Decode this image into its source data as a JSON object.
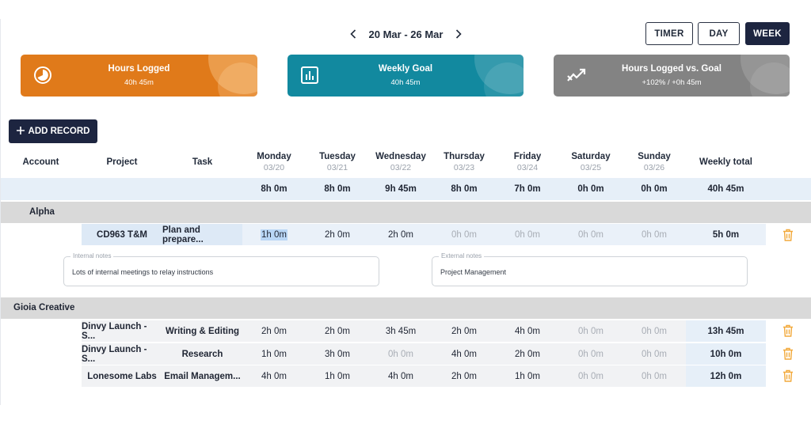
{
  "date_nav": {
    "range": "20 Mar - 26 Mar"
  },
  "views": {
    "timer": "TIMER",
    "day": "DAY",
    "week": "WEEK",
    "active": "week"
  },
  "cards": {
    "hours_logged": {
      "title": "Hours Logged",
      "value": "40h 45m",
      "color": "#e07a1a"
    },
    "weekly_goal": {
      "title": "Weekly Goal",
      "value": "40h 45m",
      "color": "#12899f"
    },
    "vs_goal": {
      "title": "Hours Logged vs. Goal",
      "value": "+102% / +0h 45m",
      "color": "#838383"
    }
  },
  "add_record": {
    "label": "ADD RECORD"
  },
  "columns": {
    "account": "Account",
    "project": "Project",
    "task": "Task",
    "days": [
      {
        "name": "Monday",
        "date": "03/20"
      },
      {
        "name": "Tuesday",
        "date": "03/21"
      },
      {
        "name": "Wednesday",
        "date": "03/22"
      },
      {
        "name": "Thursday",
        "date": "03/23"
      },
      {
        "name": "Friday",
        "date": "03/24"
      },
      {
        "name": "Saturday",
        "date": "03/25"
      },
      {
        "name": "Sunday",
        "date": "03/26"
      }
    ],
    "weekly_total": "Weekly total"
  },
  "totals": [
    "8h 0m",
    "8h 0m",
    "9h 45m",
    "8h 0m",
    "7h 0m",
    "0h 0m",
    "0h 0m",
    "40h 45m"
  ],
  "groups": [
    {
      "account": "Alpha",
      "rows": [
        {
          "project": "CD963 T&M",
          "task": "Plan and prepare...",
          "days": [
            "1h 0m",
            "2h 0m",
            "2h 0m",
            "0h 0m",
            "0h 0m",
            "0h 0m",
            "0h 0m"
          ],
          "total": "5h 0m"
        }
      ],
      "notes": {
        "internal_label": "Internal notes",
        "internal_text": "Lots of internal meetings to relay instructions",
        "external_label": "External notes",
        "external_text": "Project Management"
      }
    },
    {
      "account": "Gioia Creative",
      "rows": [
        {
          "project": "Dinvy Launch - S...",
          "task": "Writing & Editing",
          "days": [
            "2h 0m",
            "2h 0m",
            "3h 45m",
            "2h 0m",
            "4h 0m",
            "0h 0m",
            "0h 0m"
          ],
          "total": "13h 45m"
        },
        {
          "project": "Dinvy Launch - S...",
          "task": "Research",
          "days": [
            "1h 0m",
            "3h 0m",
            "0h 0m",
            "4h 0m",
            "2h 0m",
            "0h 0m",
            "0h 0m"
          ],
          "total": "10h 0m"
        },
        {
          "project": "Lonesome Labs",
          "task": "Email Managem...",
          "days": [
            "4h 0m",
            "1h 0m",
            "4h 0m",
            "2h 0m",
            "1h 0m",
            "0h 0m",
            "0h 0m"
          ],
          "total": "12h 0m"
        }
      ]
    }
  ],
  "icons": {
    "hours": "pie-clock-icon",
    "goal": "bar-chart-icon",
    "trend": "trend-line-icon",
    "delete": "trash-icon"
  },
  "accent": {
    "navy": "#1d2540",
    "trash": "#f2a93b"
  }
}
